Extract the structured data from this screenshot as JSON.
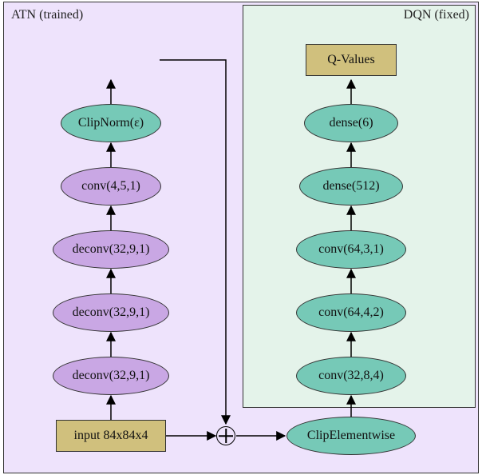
{
  "regions": {
    "left_label": "ATN (trained)",
    "right_label": "DQN (fixed)"
  },
  "nodes": {
    "input": "input 84x84x4",
    "atn1": "deconv(32,9,1)",
    "atn2": "deconv(32,9,1)",
    "atn3": "deconv(32,9,1)",
    "atn4": "conv(4,5,1)",
    "clipnorm": "ClipNorm(ε)",
    "clipelem": "ClipElementwise",
    "dqn1": "conv(32,8,4)",
    "dqn2": "conv(64,4,2)",
    "dqn3": "conv(64,3,1)",
    "dqn4": "dense(512)",
    "dqn5": "dense(6)",
    "qvalues": "Q-Values"
  },
  "chart_data": {
    "type": "diagram",
    "title": "ATN + DQN architecture",
    "regions": [
      {
        "name": "ATN (trained)",
        "color": "#eee3fc"
      },
      {
        "name": "DQN (fixed)",
        "color": "#e4f3ea"
      }
    ],
    "nodes": [
      {
        "id": "input",
        "label": "input 84x84x4",
        "shape": "rect",
        "region": "ATN",
        "color": "#d0c07d"
      },
      {
        "id": "atn1",
        "label": "deconv(32,9,1)",
        "shape": "ellipse",
        "region": "ATN",
        "color": "#c9a7e4"
      },
      {
        "id": "atn2",
        "label": "deconv(32,9,1)",
        "shape": "ellipse",
        "region": "ATN",
        "color": "#c9a7e4"
      },
      {
        "id": "atn3",
        "label": "deconv(32,9,1)",
        "shape": "ellipse",
        "region": "ATN",
        "color": "#c9a7e4"
      },
      {
        "id": "atn4",
        "label": "conv(4,5,1)",
        "shape": "ellipse",
        "region": "ATN",
        "color": "#c9a7e4"
      },
      {
        "id": "clipnorm",
        "label": "ClipNorm(ε)",
        "shape": "ellipse",
        "region": "ATN",
        "color": "#76c9b7"
      },
      {
        "id": "sum",
        "label": "⊕",
        "shape": "circle",
        "region": null,
        "color": "#ffffff"
      },
      {
        "id": "clipelem",
        "label": "ClipElementwise",
        "shape": "ellipse",
        "region": "DQN",
        "color": "#76c9b7"
      },
      {
        "id": "dqn1",
        "label": "conv(32,8,4)",
        "shape": "ellipse",
        "region": "DQN",
        "color": "#76c9b7"
      },
      {
        "id": "dqn2",
        "label": "conv(64,4,2)",
        "shape": "ellipse",
        "region": "DQN",
        "color": "#76c9b7"
      },
      {
        "id": "dqn3",
        "label": "conv(64,3,1)",
        "shape": "ellipse",
        "region": "DQN",
        "color": "#76c9b7"
      },
      {
        "id": "dqn4",
        "label": "dense(512)",
        "shape": "ellipse",
        "region": "DQN",
        "color": "#76c9b7"
      },
      {
        "id": "dqn5",
        "label": "dense(6)",
        "shape": "ellipse",
        "region": "DQN",
        "color": "#76c9b7"
      },
      {
        "id": "qvalues",
        "label": "Q-Values",
        "shape": "rect",
        "region": "DQN",
        "color": "#d0c07d"
      }
    ],
    "edges": [
      [
        "input",
        "atn1"
      ],
      [
        "atn1",
        "atn2"
      ],
      [
        "atn2",
        "atn3"
      ],
      [
        "atn3",
        "atn4"
      ],
      [
        "atn4",
        "clipnorm"
      ],
      [
        "input",
        "sum"
      ],
      [
        "clipnorm",
        "sum"
      ],
      [
        "sum",
        "clipelem"
      ],
      [
        "clipelem",
        "dqn1"
      ],
      [
        "dqn1",
        "dqn2"
      ],
      [
        "dqn2",
        "dqn3"
      ],
      [
        "dqn3",
        "dqn4"
      ],
      [
        "dqn4",
        "dqn5"
      ],
      [
        "dqn5",
        "qvalues"
      ]
    ]
  }
}
